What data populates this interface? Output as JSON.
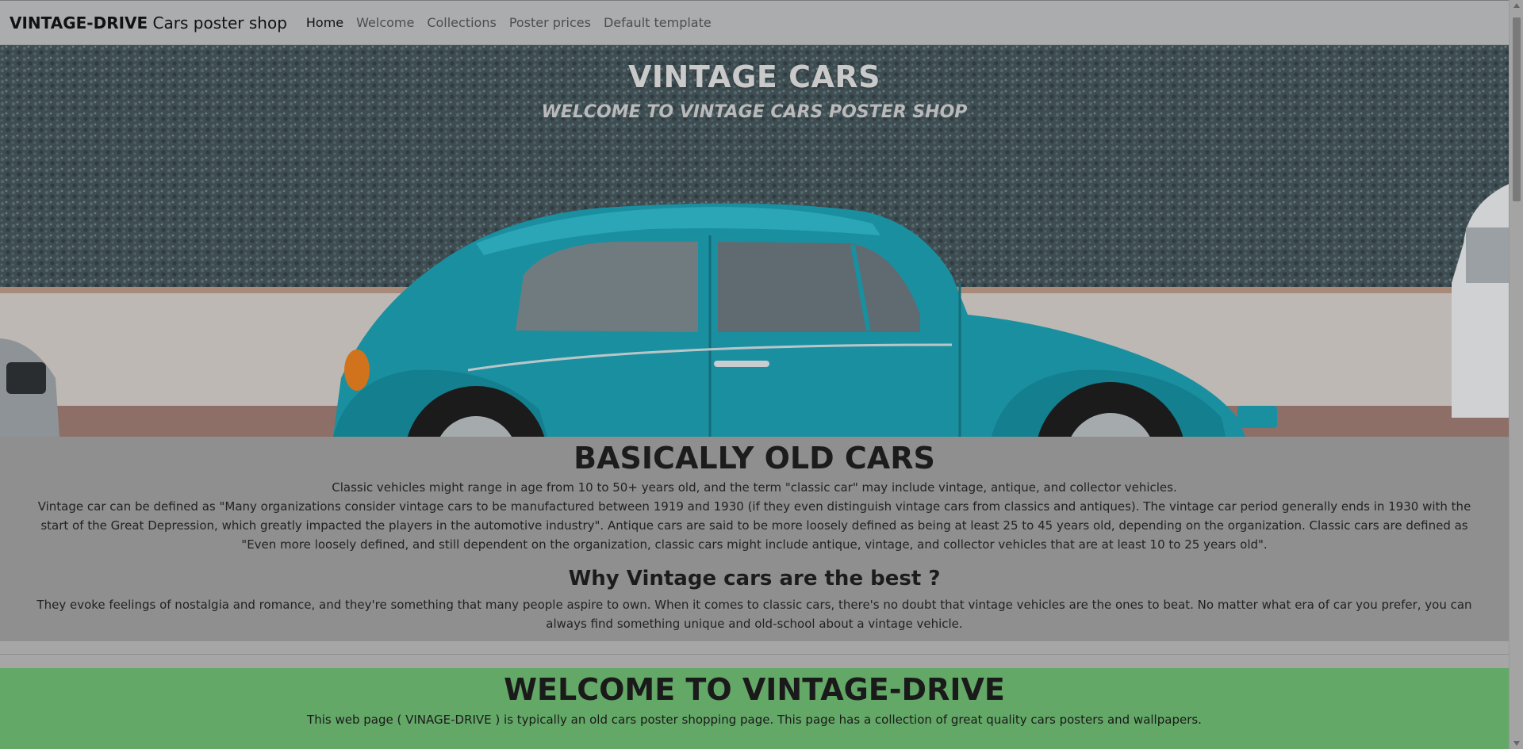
{
  "navbar": {
    "brand_bold": "VINTAGE-DRIVE",
    "brand_rest": " Cars poster shop",
    "links": [
      {
        "label": "Home"
      },
      {
        "label": "Welcome"
      },
      {
        "label": "Collections"
      },
      {
        "label": "Poster prices"
      },
      {
        "label": "Default template"
      }
    ]
  },
  "hero": {
    "title": "VINTAGE CARS",
    "subtitle": "WELCOME TO VINTAGE CARS POSTER SHOP"
  },
  "about": {
    "heading": "BASICALLY OLD CARS",
    "para1": "Classic vehicles might range in age from 10 to 50+ years old, and the term \"classic car\" may include vintage, antique, and collector vehicles.",
    "para2": "Vintage car can be defined as \"Many organizations consider vintage cars to be manufactured between 1919 and 1930 (if they even distinguish vintage cars from classics and antiques). The vintage car period generally ends in 1930 with the start of the Great Depression, which greatly impacted the players in the automotive industry\". Antique cars are said to be more loosely defined as being at least 25 to 45 years old, depending on the organization. Classic cars are defined as \"Even more loosely defined, and still dependent on the organization, classic cars might include antique, vintage, and collector vehicles that are at least 10 to 25 years old\".",
    "subheading": "Why Vintage cars are the best ?",
    "para3": "They evoke feelings of nostalgia and romance, and they're something that many people aspire to own. When it comes to classic cars, there's no doubt that vintage vehicles are the ones to beat. No matter what era of car you prefer, you can always find something unique and old-school about a vintage vehicle."
  },
  "welcome": {
    "heading": "WELCOME TO VINTAGE-DRIVE",
    "text": "This web page ( VINAGE-DRIVE ) is typically an old cars poster shopping page. This page has a collection of great quality cars posters and wallpapers."
  },
  "colors": {
    "navbar_bg": "#abacae",
    "content_bg": "#8f8f8f",
    "welcome_bg": "#63a867",
    "car_body": "#1a8fa0"
  }
}
